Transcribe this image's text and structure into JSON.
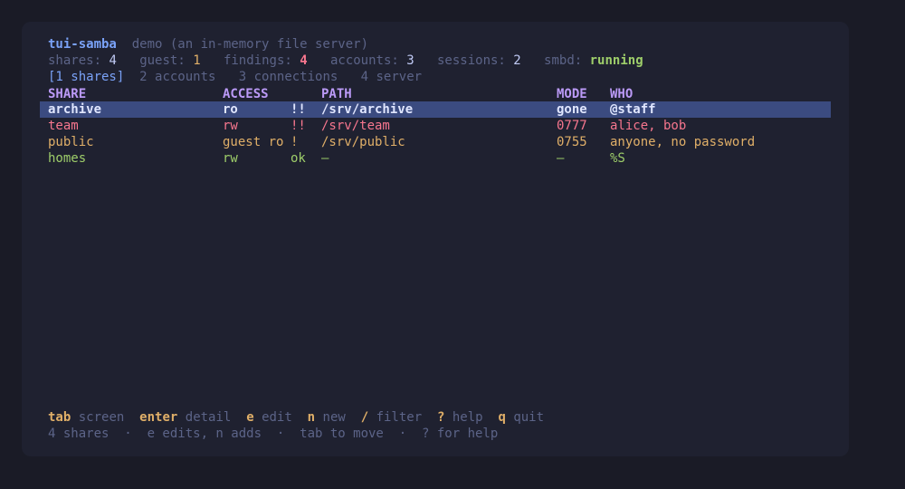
{
  "header": {
    "app_name": "tui-samba",
    "subtitle": "demo (an in-memory file server)"
  },
  "stats": {
    "shares_label": "shares:",
    "shares_value": "4",
    "guest_label": "guest:",
    "guest_value": "1",
    "findings_label": "findings:",
    "findings_value": "4",
    "accounts_label": "accounts:",
    "accounts_value": "3",
    "sessions_label": "sessions:",
    "sessions_value": "2",
    "smbd_label": "smbd:",
    "smbd_value": "running"
  },
  "tabs": [
    {
      "label": "[1 shares]"
    },
    {
      "label": "2 accounts"
    },
    {
      "label": "3 connections"
    },
    {
      "label": "4 server"
    }
  ],
  "table": {
    "columns": {
      "share": "SHARE",
      "access": "ACCESS",
      "path": "PATH",
      "mode": "MODE",
      "who": "WHO"
    },
    "rows": [
      {
        "share": "archive",
        "access": "ro",
        "flag": "!!",
        "path": "/srv/archive",
        "mode": "gone",
        "who": "@staff"
      },
      {
        "share": "team",
        "access": "rw",
        "flag": "!!",
        "path": "/srv/team",
        "mode": "0777",
        "who": "alice, bob"
      },
      {
        "share": "public",
        "access": "guest ro",
        "flag": "!",
        "path": "/srv/public",
        "mode": "0755",
        "who": "anyone, no password"
      },
      {
        "share": "homes",
        "access": "rw",
        "flag": "ok",
        "path": "—",
        "mode": "—",
        "who": "%S"
      }
    ]
  },
  "keybar": [
    {
      "key": "tab",
      "desc": "screen"
    },
    {
      "key": "enter",
      "desc": "detail"
    },
    {
      "key": "e",
      "desc": "edit"
    },
    {
      "key": "n",
      "desc": "new"
    },
    {
      "key": "/",
      "desc": "filter"
    },
    {
      "key": "?",
      "desc": "help"
    },
    {
      "key": "q",
      "desc": "quit"
    }
  ],
  "footer": {
    "status": "4 shares  ·  e edits, n adds  ·  tab to move  ·  ? for help"
  }
}
